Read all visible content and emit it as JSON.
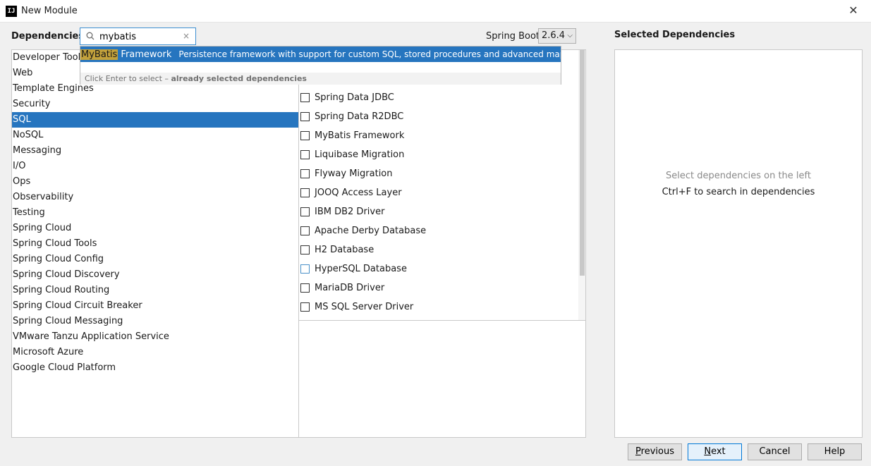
{
  "window": {
    "title": "New Module",
    "app_icon": "IJ"
  },
  "dependencies_label": "Dependencies",
  "search": {
    "value": "mybatis",
    "clear_icon": "×"
  },
  "spring_boot": {
    "label": "Spring Boot",
    "version": "2.6.4"
  },
  "categories": [
    "Developer Tools",
    "Web",
    "Template Engines",
    "Security",
    "SQL",
    "NoSQL",
    "Messaging",
    "I/O",
    "Ops",
    "Observability",
    "Testing",
    "Spring Cloud",
    "Spring Cloud Tools",
    "Spring Cloud Config",
    "Spring Cloud Discovery",
    "Spring Cloud Routing",
    "Spring Cloud Circuit Breaker",
    "Spring Cloud Messaging",
    "VMware Tanzu Application Service",
    "Microsoft Azure",
    "Google Cloud Platform"
  ],
  "selected_category": "SQL",
  "dependencies": [
    "Spring Data JDBC",
    "Spring Data R2DBC",
    "MyBatis Framework",
    "Liquibase Migration",
    "Flyway Migration",
    "JOOQ Access Layer",
    "IBM DB2 Driver",
    "Apache Derby Database",
    "H2 Database",
    "HyperSQL Database",
    "MariaDB Driver",
    "MS SQL Server Driver"
  ],
  "popup": {
    "match_highlight": "MyBatis",
    "match_rest": " Framework",
    "description": "Persistence framework with support for custom SQL, stored procedures and advanced mappings. MyBat...",
    "hint_prefix": "Click Enter to select – ",
    "hint_bold": "already selected dependencies"
  },
  "selected_dependencies": {
    "title": "Selected Dependencies",
    "empty_line1": "Select dependencies on the left",
    "empty_line2": "Ctrl+F to search in dependencies"
  },
  "buttons": {
    "previous": {
      "mnemonic": "P",
      "rest": "revious"
    },
    "next": {
      "mnemonic": "N",
      "rest": "ext"
    },
    "cancel": "Cancel",
    "help": "Help"
  },
  "colors": {
    "selection": "#2675bf",
    "match_highlight": "#c3a13b",
    "primary_button_border": "#0078d7"
  }
}
